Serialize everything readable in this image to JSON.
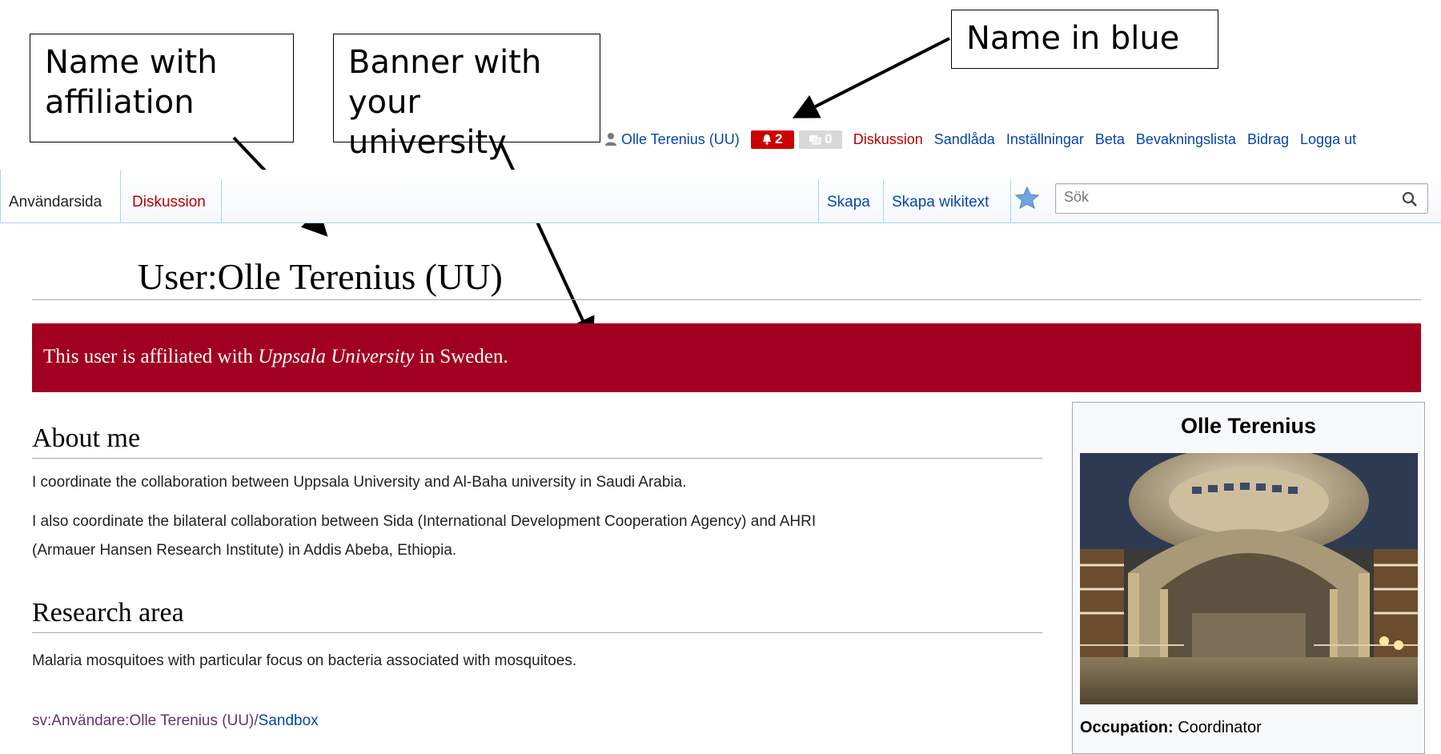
{
  "annotations": {
    "affiliation": "Name with affiliation",
    "banner": "Banner with your university",
    "name_blue": "Name in blue"
  },
  "personal_tools": {
    "user_name": "Olle Terenius (UU)",
    "notifications_count": "2",
    "messages_count": "0",
    "links": [
      "Diskussion",
      "Sandlåda",
      "Inställningar",
      "Beta",
      "Bevakningslista",
      "Bidrag",
      "Logga ut"
    ]
  },
  "tabs": {
    "user_page": "Användarsida",
    "talk": "Diskussion",
    "create": "Skapa",
    "create_wikitext": "Skapa wikitext"
  },
  "search": {
    "placeholder": "Sök"
  },
  "page": {
    "title": "User:Olle Terenius (UU)",
    "banner_prefix": "This user is affiliated with ",
    "banner_university": "Uppsala University",
    "banner_suffix": " in Sweden."
  },
  "sections": {
    "about_heading": "About me",
    "about_p1": "I coordinate the collaboration between Uppsala University and Al-Baha university in Saudi Arabia.",
    "about_p2_line1": "I also coordinate the bilateral collaboration between Sida (International Development Cooperation Agency) and AHRI",
    "about_p2_line2": "(Armauer Hansen Research Institute) in Addis Abeba, Ethiopia.",
    "research_heading": "Research area",
    "research_p": "Malaria mosquitoes with particular focus on bacteria associated with mosquitoes."
  },
  "sandbox_link": {
    "prefix": "sv:Användare:Olle Terenius (UU)/",
    "label": "Sandbox"
  },
  "infobox": {
    "title": "Olle Terenius",
    "occupation_label": "Occupation:",
    "occupation_value": " Coordinator"
  },
  "colors": {
    "banner": "#a10020",
    "link_blue": "#0645ad",
    "link_red": "#ba0000",
    "badge_red": "#cc0000"
  }
}
